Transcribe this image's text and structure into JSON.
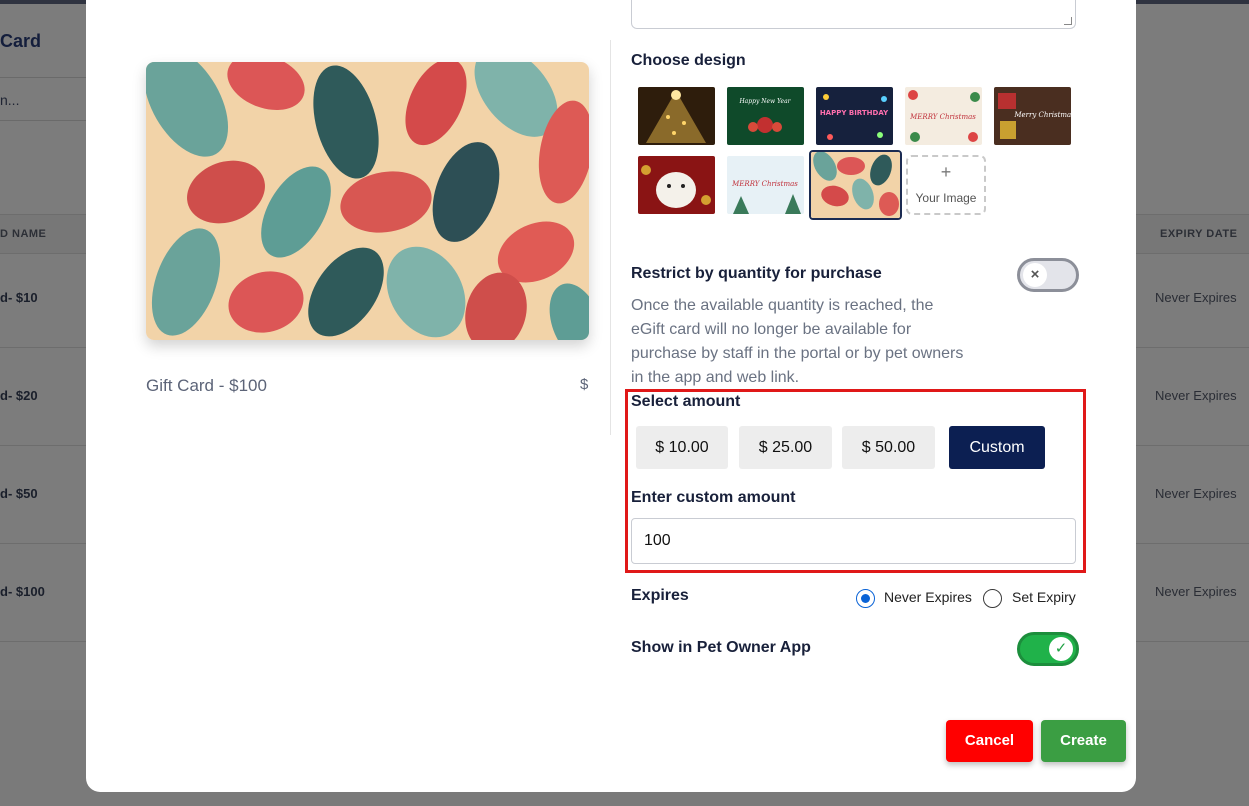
{
  "background": {
    "title": "Card",
    "search_placeholder": "n...",
    "table_headers": {
      "name": "D NAME",
      "expiry": "EXPIRY DATE"
    },
    "rows": [
      {
        "name": "d- $10",
        "expiry": "Never Expires"
      },
      {
        "name": "d- $20",
        "expiry": "Never Expires"
      },
      {
        "name": "d- $50",
        "expiry": "Never Expires"
      },
      {
        "name": "d- $100",
        "expiry": "Never Expires"
      }
    ]
  },
  "modal": {
    "preview": {
      "name": "Gift Card - $100",
      "price": "$"
    },
    "choose_design_label": "Choose design",
    "designs": [
      {
        "name": "christmas-tree-lights"
      },
      {
        "name": "happy-new-year",
        "text": "Happy New Year"
      },
      {
        "name": "happy-birthday",
        "text": "HAPPY BIRTHDAY"
      },
      {
        "name": "merry-christmas-cookies",
        "text": "MERRY Christmas"
      },
      {
        "name": "merry-christmas-gifts",
        "text": "Merry Christmas!"
      },
      {
        "name": "christmas-dog"
      },
      {
        "name": "merry-christmas-snow",
        "text": "MERRY Christmas"
      },
      {
        "name": "leaf-pattern",
        "selected": true
      }
    ],
    "your_image_label": "Your Image",
    "restrict_label": "Restrict by quantity for purchase",
    "restrict_help": "Once the available quantity is reached, the eGift card will no longer be available for purchase by staff in the portal or by pet owners in the app and web link.",
    "restrict_enabled": false,
    "select_amount_label": "Select amount",
    "amount_options": [
      "$ 10.00",
      "$ 25.00",
      "$ 50.00",
      "Custom"
    ],
    "selected_amount": "Custom",
    "custom_amount_label": "Enter custom amount",
    "custom_amount_value": "100",
    "expires_label": "Expires",
    "expiry_options": [
      "Never Expires",
      "Set Expiry"
    ],
    "selected_expiry": "Never Expires",
    "show_in_app_label": "Show in Pet Owner App",
    "show_in_app_enabled": true,
    "cancel_label": "Cancel",
    "create_label": "Create"
  },
  "colors": {
    "primary_navy": "#0c1f52",
    "cancel_red": "#ff0000",
    "create_green": "#3b9e43",
    "toggle_on_green": "#20b24a",
    "highlight_red": "#e01818"
  }
}
